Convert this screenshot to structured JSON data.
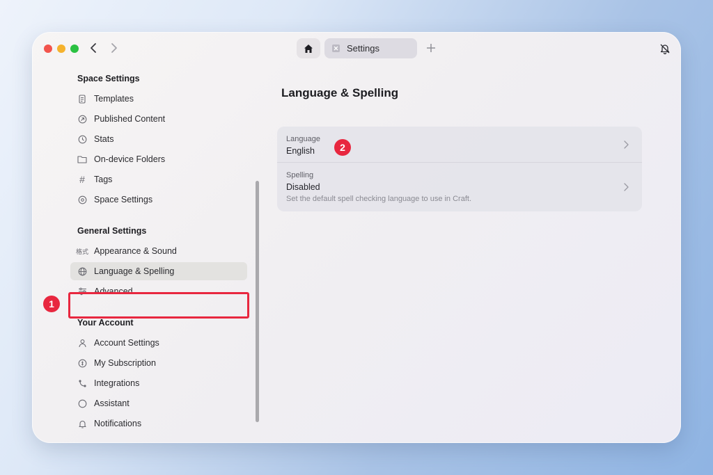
{
  "tabs": {
    "home_icon": "home-icon",
    "active_tab_label": "Settings"
  },
  "sidebar": {
    "sections": [
      {
        "header": "Space Settings",
        "items": [
          {
            "label": "Templates",
            "icon": "document-icon"
          },
          {
            "label": "Published Content",
            "icon": "published-icon"
          },
          {
            "label": "Stats",
            "icon": "clock-icon"
          },
          {
            "label": "On-device Folders",
            "icon": "folder-icon"
          },
          {
            "label": "Tags",
            "icon": "hashtag-icon"
          },
          {
            "label": "Space Settings",
            "icon": "gear-icon"
          }
        ]
      },
      {
        "header": "General Settings",
        "items": [
          {
            "label": "Appearance & Sound",
            "icon": "appearance-icon",
            "icon_text": "格式"
          },
          {
            "label": "Language & Spelling",
            "icon": "globe-icon"
          },
          {
            "label": "Advanced",
            "icon": "sliders-icon"
          }
        ]
      },
      {
        "header": "Your Account",
        "items": [
          {
            "label": "Account Settings",
            "icon": "person-icon"
          },
          {
            "label": "My Subscription",
            "icon": "subscription-icon"
          },
          {
            "label": "Integrations",
            "icon": "integrations-icon"
          },
          {
            "label": "Assistant",
            "icon": "circle-icon"
          },
          {
            "label": "Notifications",
            "icon": "bell-icon"
          }
        ]
      }
    ],
    "active_item": "Language & Spelling"
  },
  "main": {
    "title": "Language & Spelling",
    "rows": [
      {
        "caption": "Language",
        "value": "English"
      },
      {
        "caption": "Spelling",
        "value": "Disabled",
        "description": "Set the default spell checking language to use in Craft."
      }
    ]
  },
  "annotations": {
    "badge_1": "1",
    "badge_2": "2",
    "color": "#e8273f"
  }
}
